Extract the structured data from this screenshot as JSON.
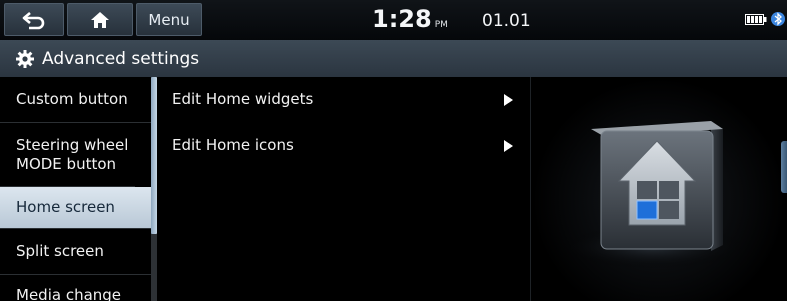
{
  "statusbar": {
    "back_icon": "back-arrow-icon",
    "home_icon": "home-icon",
    "menu_label": "Menu",
    "time": "1:28",
    "ampm": "PM",
    "date": "01.01",
    "battery_icon": "battery-icon",
    "bluetooth_icon": "bluetooth-icon"
  },
  "titlebar": {
    "icon": "gear-icon",
    "title": "Advanced settings"
  },
  "left_menu": {
    "items": [
      {
        "label": "Custom button",
        "selected": false
      },
      {
        "label": "Steering wheel MODE button",
        "selected": false
      },
      {
        "label": "Home screen",
        "selected": true
      },
      {
        "label": "Split screen",
        "selected": false
      },
      {
        "label": "Media change",
        "selected": false
      }
    ]
  },
  "main_list": {
    "items": [
      {
        "label": "Edit Home widgets",
        "icon": "chevron-right-icon"
      },
      {
        "label": "Edit Home icons",
        "icon": "chevron-right-icon"
      }
    ]
  },
  "preview": {
    "icon": "home-screen-illustration-icon"
  },
  "colors": {
    "accent": "#b9c8d6",
    "header": "#2b3540",
    "background": "#000000",
    "highlight_blue": "#1e6fd9"
  }
}
